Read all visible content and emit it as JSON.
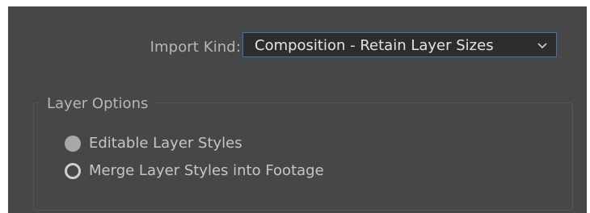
{
  "import_kind": {
    "label": "Import Kind:",
    "value": "Composition - Retain Layer Sizes",
    "chevron_icon": "chevron-down-icon"
  },
  "layer_options": {
    "title": "Layer Options",
    "options": [
      {
        "label": "Editable Layer Styles",
        "state": "disabled"
      },
      {
        "label": "Merge Layer Styles into Footage",
        "state": "unselected"
      }
    ]
  },
  "colors": {
    "panel_bg": "#474747",
    "select_border": "#3e73b6",
    "select_bg": "#2d2d2d"
  }
}
